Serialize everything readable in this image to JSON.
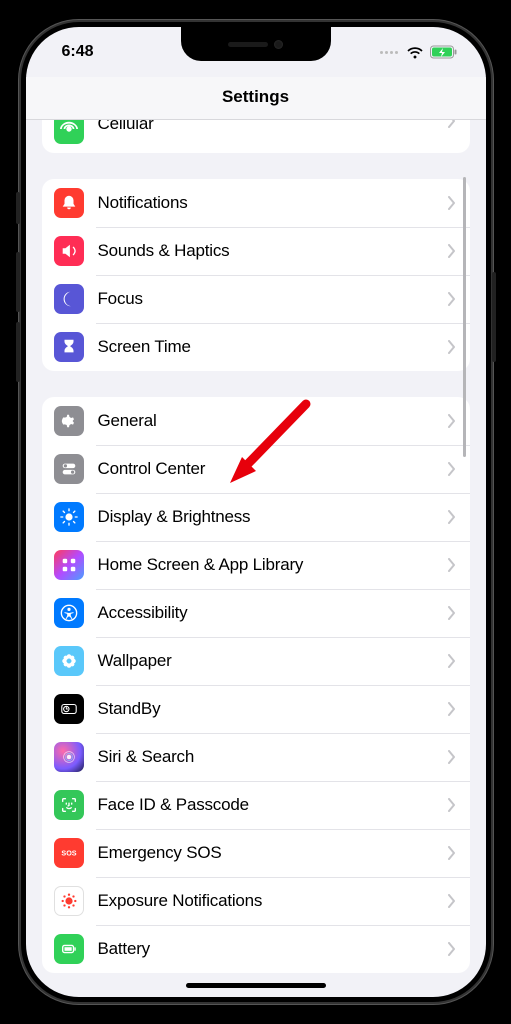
{
  "status": {
    "time": "6:48"
  },
  "header": {
    "title": "Settings"
  },
  "groups": [
    {
      "partial": true,
      "items": [
        {
          "key": "cellular",
          "label": "Cellular",
          "icon": "antenna-icon",
          "bg": "bg-green"
        }
      ]
    },
    {
      "items": [
        {
          "key": "notifications",
          "label": "Notifications",
          "icon": "bell-icon",
          "bg": "bg-red"
        },
        {
          "key": "sounds",
          "label": "Sounds & Haptics",
          "icon": "speaker-icon",
          "bg": "bg-pink"
        },
        {
          "key": "focus",
          "label": "Focus",
          "icon": "moon-icon",
          "bg": "bg-indigo"
        },
        {
          "key": "screentime",
          "label": "Screen Time",
          "icon": "hourglass-icon",
          "bg": "bg-indigo"
        }
      ]
    },
    {
      "items": [
        {
          "key": "general",
          "label": "General",
          "icon": "gear-icon",
          "bg": "bg-gray"
        },
        {
          "key": "controlcenter",
          "label": "Control Center",
          "icon": "switches-icon",
          "bg": "bg-gray"
        },
        {
          "key": "display",
          "label": "Display & Brightness",
          "icon": "sun-icon",
          "bg": "bg-blue"
        },
        {
          "key": "homescreen",
          "label": "Home Screen & App Library",
          "icon": "grid-icon",
          "bg": "bg-multi"
        },
        {
          "key": "accessibility",
          "label": "Accessibility",
          "icon": "person-icon",
          "bg": "bg-blue"
        },
        {
          "key": "wallpaper",
          "label": "Wallpaper",
          "icon": "flower-icon",
          "bg": "bg-cyan"
        },
        {
          "key": "standby",
          "label": "StandBy",
          "icon": "clock-icon",
          "bg": "bg-black"
        },
        {
          "key": "siri",
          "label": "Siri & Search",
          "icon": "siri-icon",
          "bg": "bg-siri"
        },
        {
          "key": "faceid",
          "label": "Face ID & Passcode",
          "icon": "faceid-icon",
          "bg": "bg-facegreen"
        },
        {
          "key": "sos",
          "label": "Emergency SOS",
          "icon": "sos-text-icon",
          "bg": "bg-sos"
        },
        {
          "key": "exposure",
          "label": "Exposure Notifications",
          "icon": "virus-icon",
          "bg": "bg-white"
        },
        {
          "key": "battery",
          "label": "Battery",
          "icon": "battery-icon-row",
          "bg": "bg-green"
        }
      ]
    }
  ]
}
